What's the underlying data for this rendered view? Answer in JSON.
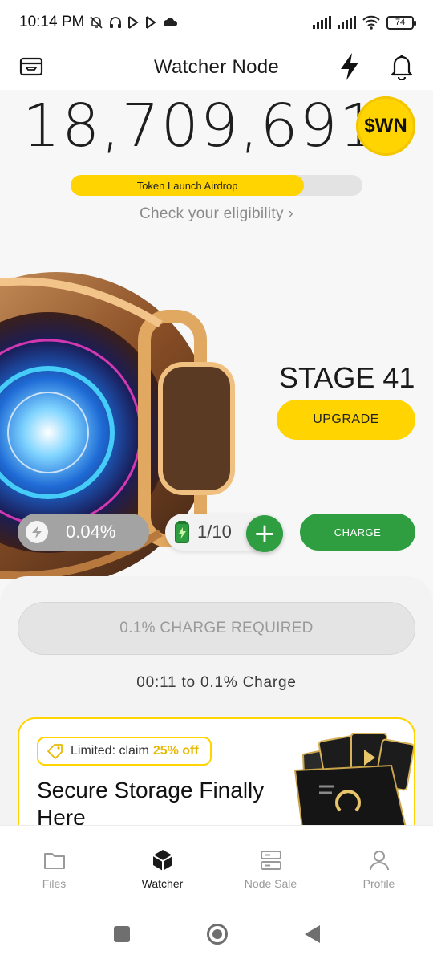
{
  "status_bar": {
    "time": "10:14 PM",
    "battery": "74",
    "icons": [
      "bell-off-icon",
      "headset-icon",
      "app-icon",
      "app-icon",
      "cloud-icon",
      "signal-icon",
      "signal-icon",
      "wifi-icon",
      "battery-icon"
    ]
  },
  "app_bar": {
    "title": "Watcher Node",
    "icons": [
      "wallet-icon",
      "bolt-icon",
      "bell-icon"
    ]
  },
  "balance": {
    "amount": "18,709,691",
    "token": "$WN"
  },
  "airdrop": {
    "label": "Token Launch Airdrop",
    "progress": 0.8,
    "link": "Check your eligibility ›"
  },
  "node": {
    "stage": "STAGE 41",
    "upgrade_label": "UPGRADE",
    "charge_percent": "0.04%",
    "charges": "1/10",
    "add_label": "+",
    "charge_label": "CHARGE"
  },
  "sheet": {
    "required_label": "0.1% CHARGE REQUIRED",
    "timer": "00:11 to 0.1% Charge"
  },
  "promo": {
    "badge_prefix": "Limited: claim",
    "badge_accent": "25% off",
    "title": "Secure Storage Finally Here"
  },
  "bottom_nav": {
    "items": [
      {
        "label": "Files",
        "icon": "folder-icon"
      },
      {
        "label": "Watcher",
        "icon": "cube-icon"
      },
      {
        "label": "Node Sale",
        "icon": "server-icon"
      },
      {
        "label": "Profile",
        "icon": "user-icon"
      }
    ],
    "active": "Watcher"
  },
  "colors": {
    "accent_yellow": "#ffd400",
    "accent_green": "#2f9e41",
    "disabled_gray": "#a3a3a3"
  }
}
